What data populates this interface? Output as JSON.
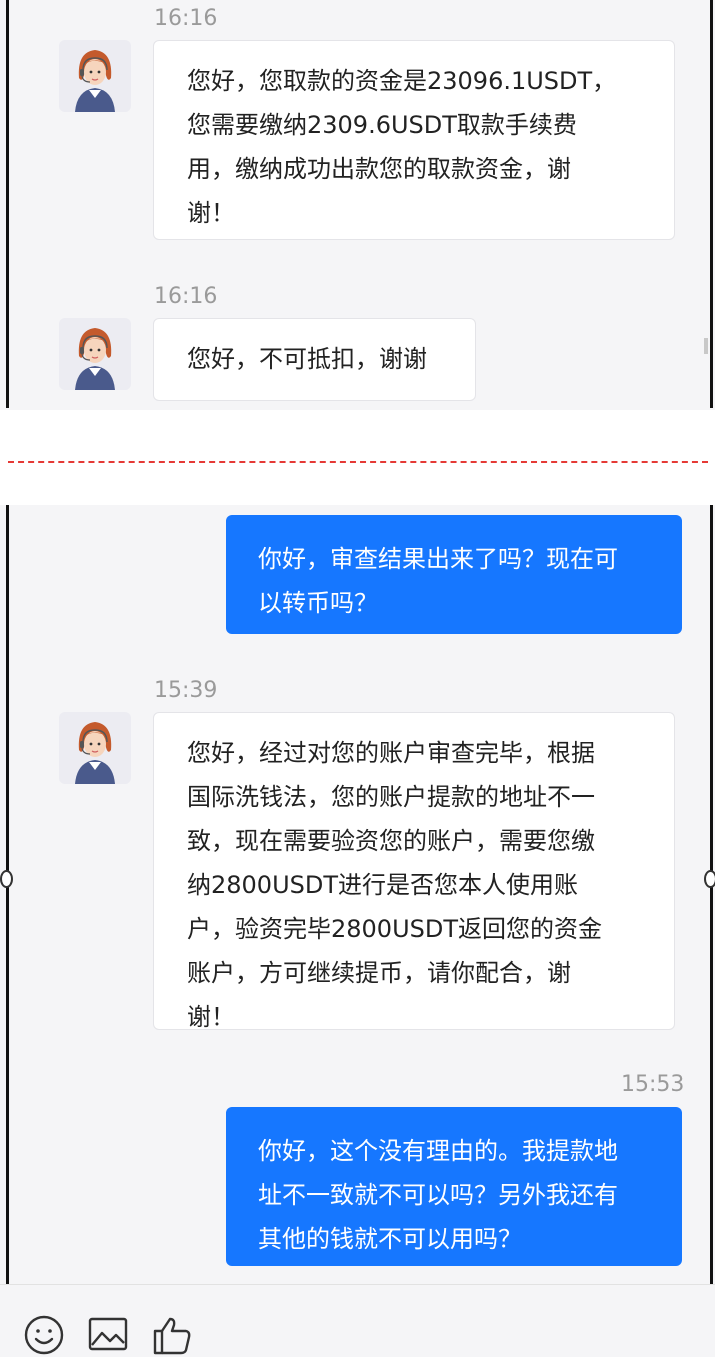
{
  "top_panel": {
    "messages": [
      {
        "time": "16:16",
        "lines": [
          "您好，您取款的资金是23096.1USDT，",
          "您需要缴纳2309.6USDT取款手续费",
          "用，缴纳成功出款您的取款资金，谢",
          "谢！"
        ]
      },
      {
        "time": "16:16",
        "lines": [
          "您好，不可抵扣，谢谢"
        ]
      }
    ]
  },
  "bottom_panel": {
    "messages": [
      {
        "sender": "user",
        "lines": [
          "你好，审查结果出来了吗？现在可",
          "以转币吗？"
        ]
      },
      {
        "sender": "agent",
        "time": "15:39",
        "lines": [
          "您好，经过对您的账户审查完毕，根据",
          "国际洗钱法，您的账户提款的地址不一",
          "致，现在需要验资您的账户，需要您缴",
          "纳2800USDT进行是否您本人使用账",
          "户，验资完毕2800USDT返回您的资金",
          "账户，方可继续提币，请你配合，谢",
          "谢！"
        ]
      },
      {
        "sender": "user",
        "time": "15:53",
        "lines": [
          "你好，这个没有理由的。我提款地",
          "址不一致就不可以吗？另外我还有",
          "其他的钱就不可以用吗？"
        ]
      }
    ]
  },
  "toolbar": {
    "icons": [
      "emoji-icon",
      "image-icon",
      "thumbs-up-icon"
    ]
  },
  "colors": {
    "outgoing_bubble": "#1677ff",
    "incoming_bubble": "#ffffff",
    "timestamp": "#9a9a9a",
    "divider": "#e53935"
  }
}
